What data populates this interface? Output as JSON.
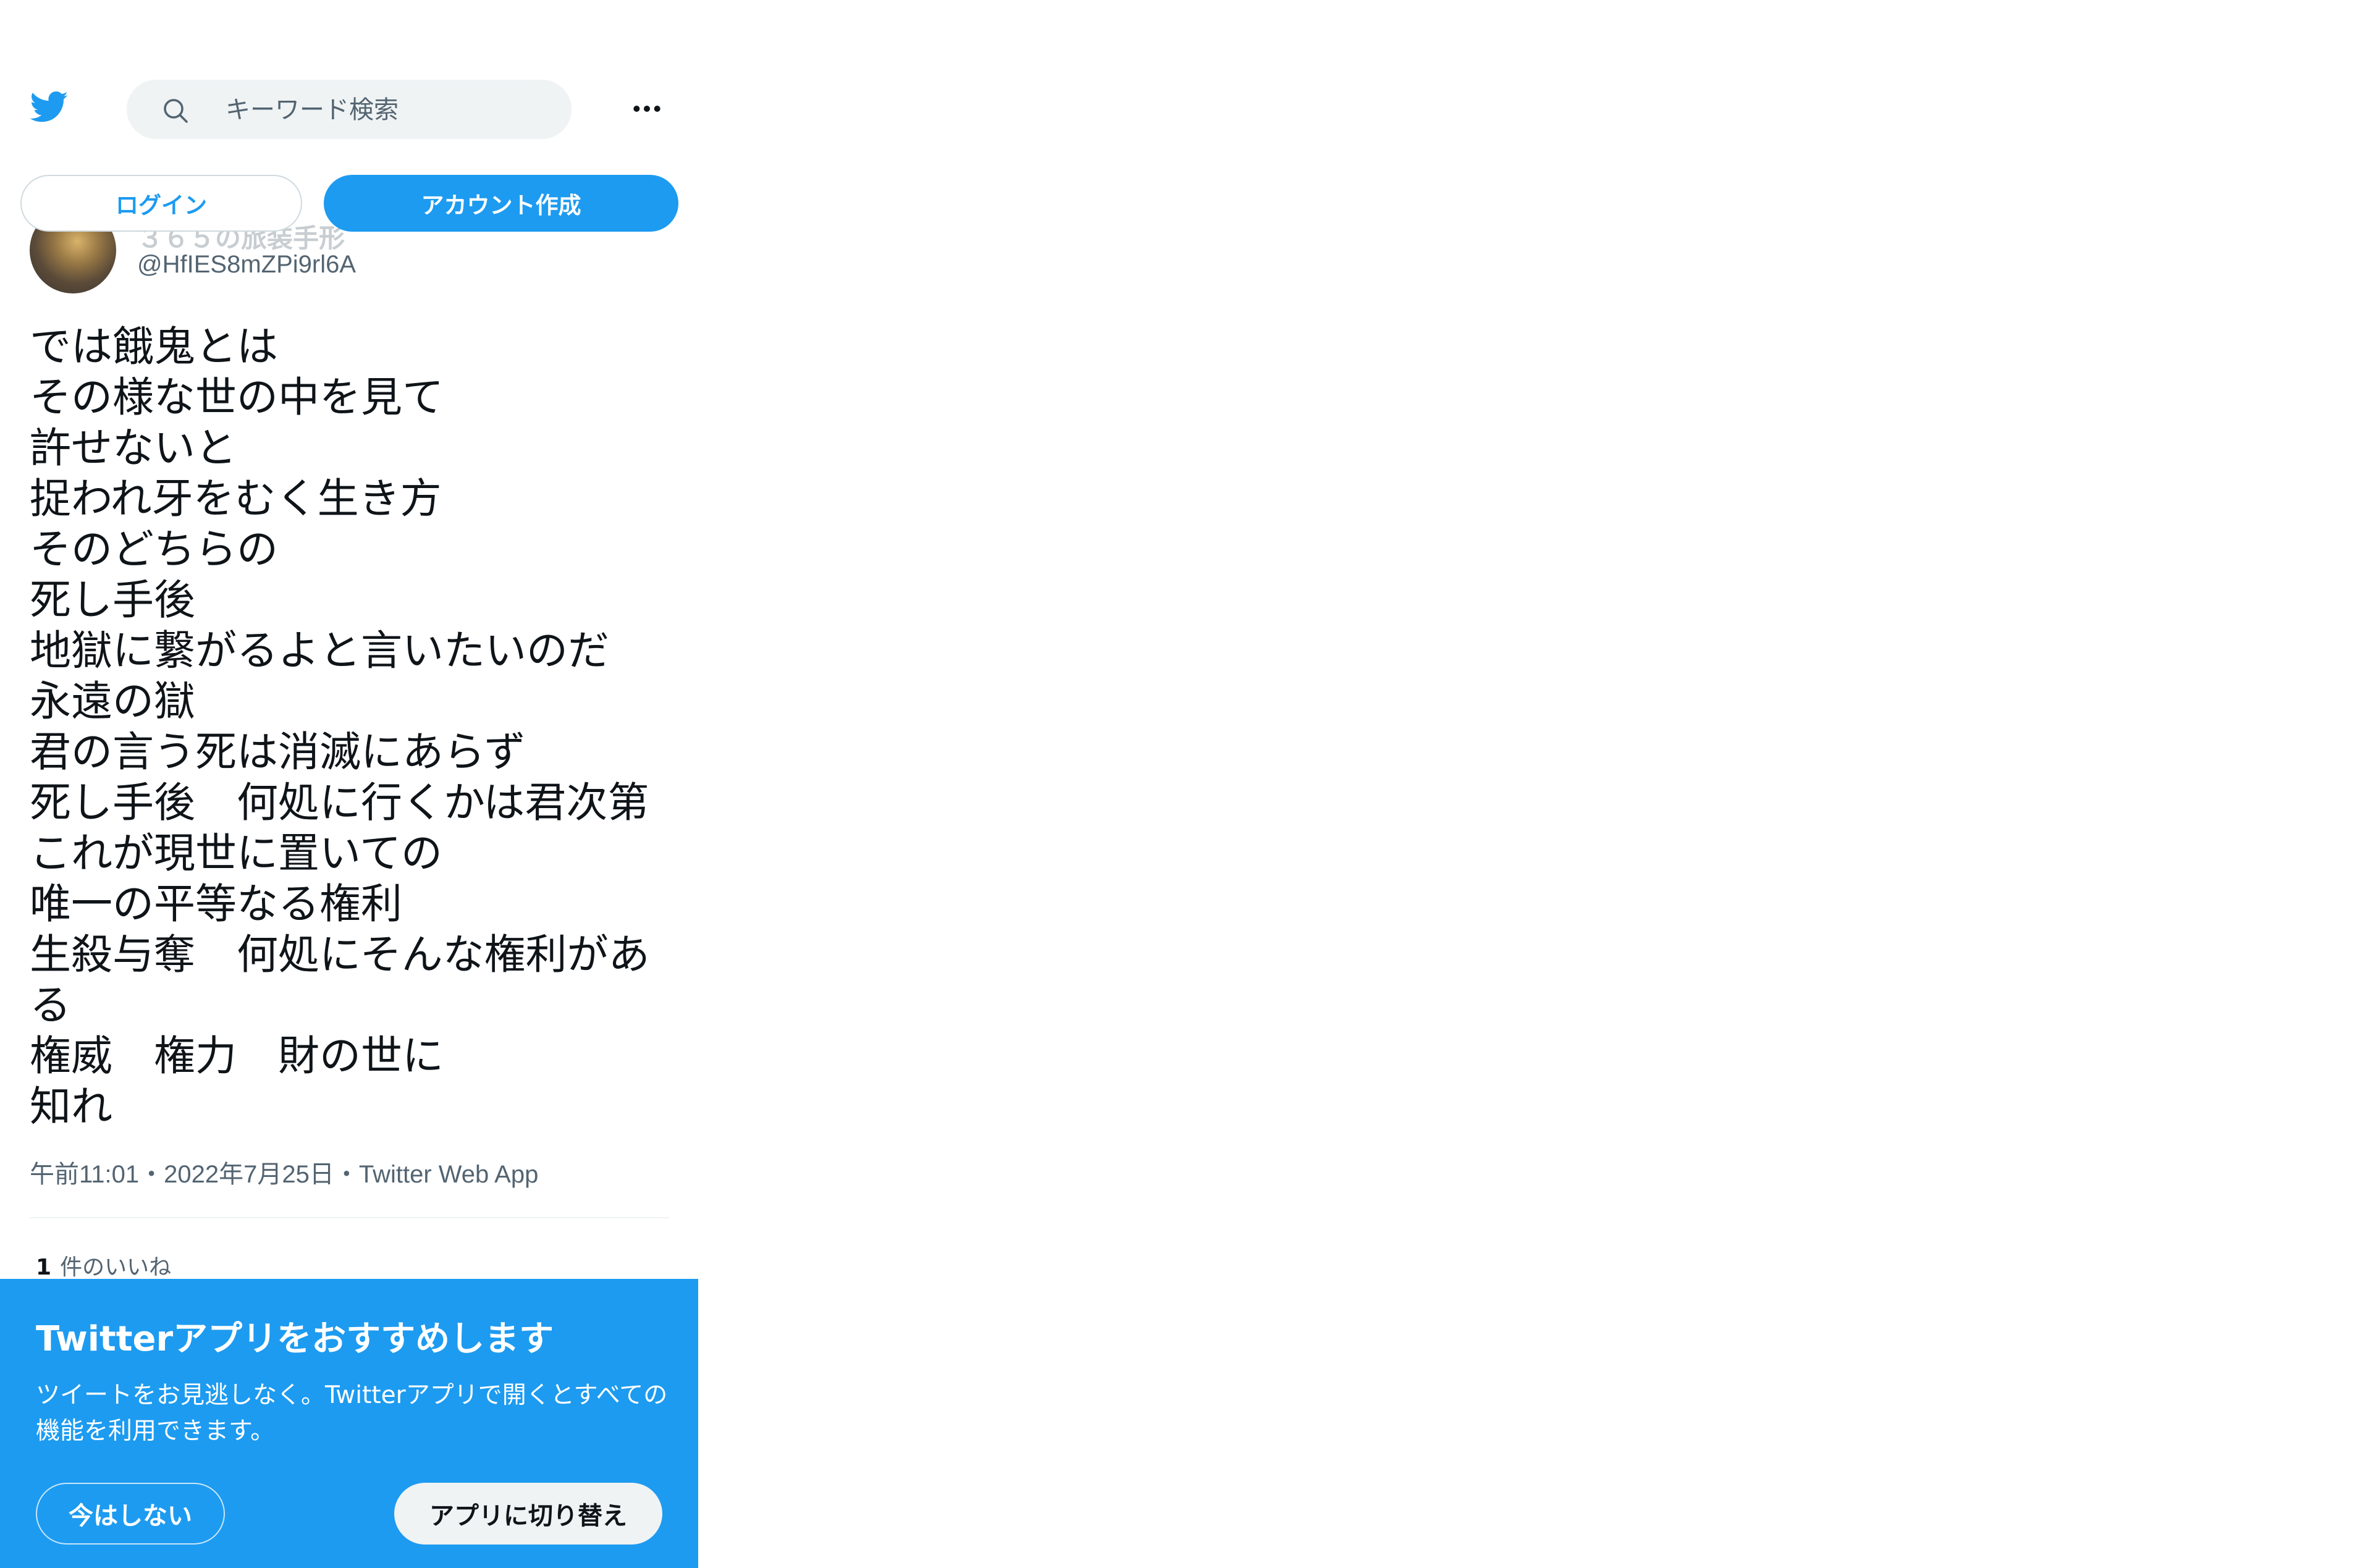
{
  "header": {
    "search_placeholder": "キーワード検索",
    "login_label": "ログイン",
    "signup_label": "アカウント作成",
    "icons": {
      "logo": "twitter-bird-icon",
      "search": "search-icon",
      "more": "more-dots-icon"
    }
  },
  "tweet": {
    "display_name": "３６５の旅装手形",
    "handle": "@HfIES8mZPi9rl6A",
    "text": "では餓鬼とは\nその様な世の中を見て\n許せないと\n捉われ牙をむく生き方\nそのどちらの\n死し手後\n地獄に繋がるよと言いたいのだ\n永遠の獄\n君の言う死は消滅にあらず\n死し手後　何処に行くかは君次第\nこれが現世に置いての\n唯一の平等なる権利\n生殺与奪　何処にそんな権利がある\n権威　権力　財の世に\n知れ",
    "meta": "午前11:01・2022年7月25日・Twitter Web App",
    "likes_count": "1",
    "likes_label": "件のいいね"
  },
  "banner": {
    "title": "Twitterアプリをおすすめします",
    "description": "ツイートをお見逃しなく。Twitterアプリで開くとすべての機能を利用できます。",
    "not_now_label": "今はしない",
    "switch_label": "アプリに切り替え"
  },
  "colors": {
    "accent": "#1d9bf0",
    "text": "#0f1419",
    "secondary": "#536471",
    "search_bg": "#eff3f4"
  }
}
